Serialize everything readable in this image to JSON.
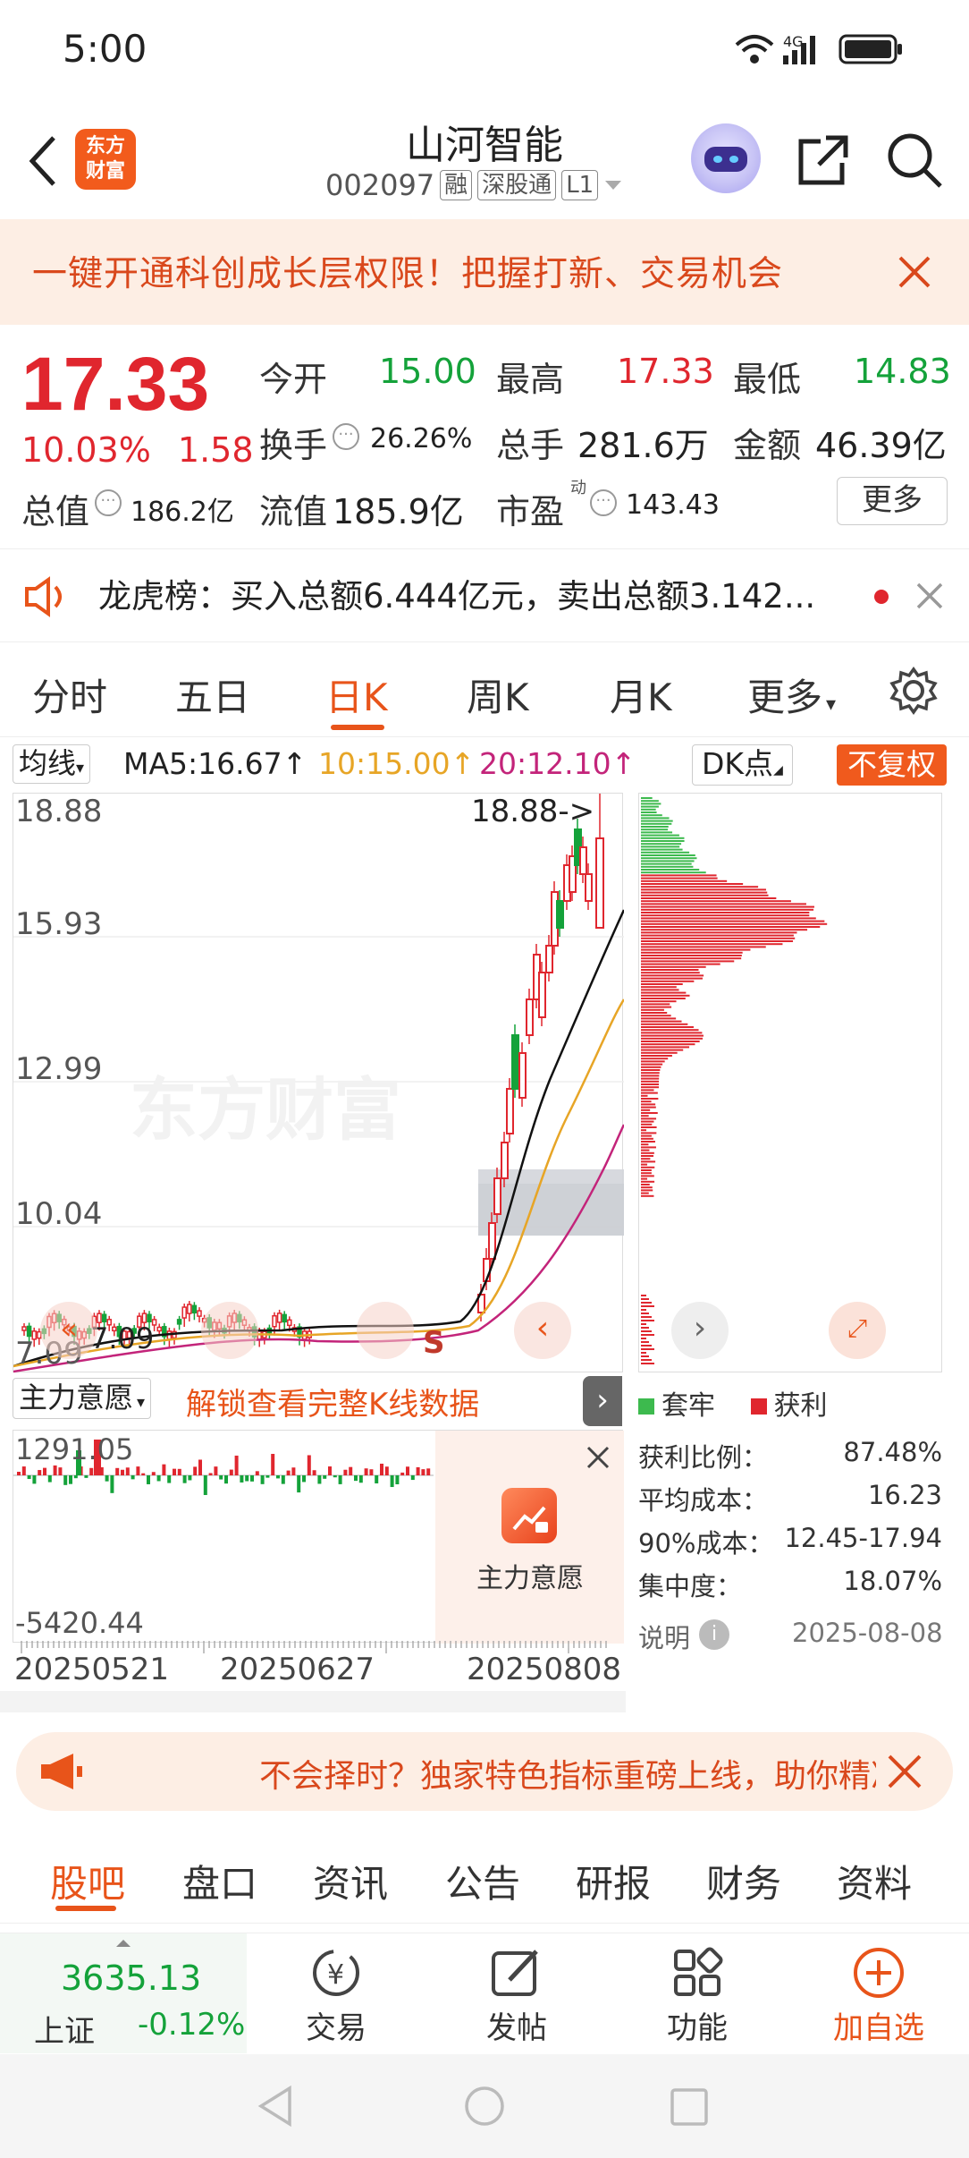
{
  "status": {
    "time": "5:00"
  },
  "header": {
    "stock_name": "山河智能",
    "code": "002097",
    "tags": [
      "融",
      "深股通",
      "L1"
    ],
    "logo_text_line1": "东方",
    "logo_text_line2": "财富"
  },
  "banner": {
    "text": "一键开通科创成长层权限！把握打新、交易机会"
  },
  "quote": {
    "price": "17.33",
    "change_pct": "10.03%",
    "change": "1.58",
    "open_label": "今开",
    "open": "15.00",
    "high_label": "最高",
    "high": "17.33",
    "low_label": "最低",
    "low": "14.83",
    "turnover_label": "换手",
    "turnover": "26.26%",
    "volume_label": "总手",
    "volume": "281.6万",
    "amount_label": "金额",
    "amount": "46.39亿",
    "mktcap_label": "总值",
    "mktcap": "186.2亿",
    "float_label": "流值",
    "float_cap": "185.9亿",
    "pe_label": "市盈",
    "pe_sup": "动",
    "pe": "143.43",
    "more_button": "更多"
  },
  "dragon": {
    "text": "龙虎榜：买入总额6.444亿元，卖出总额3.142..."
  },
  "ktabs": [
    "分时",
    "五日",
    "日K",
    "周K",
    "月K",
    "更多"
  ],
  "ktabs_active": "日K",
  "ma_bar": {
    "selector": "均线",
    "ma5": "MA5:16.67",
    "ma10": "10:15.00",
    "ma20": "20:12.10",
    "dk_button": "DK点",
    "fq_button": "不复权"
  },
  "kchart": {
    "y_labels": [
      "18.88",
      "15.93",
      "12.99",
      "10.04",
      "7.09"
    ],
    "max_annot": "18.88->",
    "min_annot": "7.09",
    "signal_label": "S",
    "watermark": "东方财富"
  },
  "indicator": {
    "selector": "主力意愿",
    "unlock_text": "解锁查看完整K线数据",
    "top_value": "1291.05",
    "bottom_value": "-5420.44",
    "lock_label": "主力意愿",
    "dates": [
      "20250521",
      "20250627",
      "20250808"
    ]
  },
  "distribution": {
    "legend_trapped": "套牢",
    "legend_profit": "获利",
    "rows": [
      {
        "label": "获利比例：",
        "value": "87.48%"
      },
      {
        "label": "平均成本：",
        "value": "16.23"
      },
      {
        "label": "90%成本：",
        "value": "12.45-17.94"
      },
      {
        "label": "集中度：",
        "value": "18.07%"
      }
    ],
    "note_label": "说明",
    "date": "2025-08-08"
  },
  "adbar": {
    "text": "不会择时？独家特色指标重磅上线，助你精准把握"
  },
  "sectabs": [
    "股吧",
    "盘口",
    "资讯",
    "公告",
    "研报",
    "财务",
    "资料"
  ],
  "sectabs_active": "股吧",
  "index": {
    "value": "3635.13",
    "name": "上证",
    "change": "-0.12%"
  },
  "bottom": {
    "trade": "交易",
    "post": "发帖",
    "func": "功能",
    "watch": "加自选"
  },
  "colors": {
    "up": "#e0262e",
    "down": "#14a23a",
    "accent": "#e8541a"
  }
}
